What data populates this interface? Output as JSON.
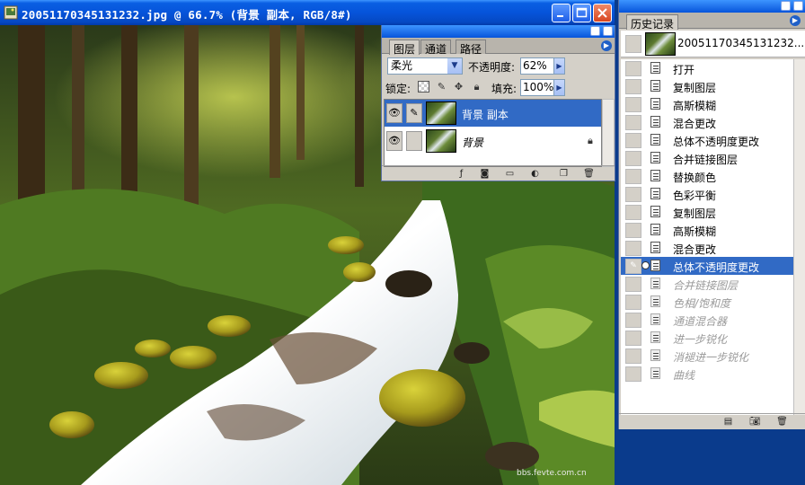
{
  "document": {
    "title": "20051170345131232.jpg @ 66.7% (背景 副本, RGB/8#)",
    "watermark": "bbs.fevte.com.cn"
  },
  "layers_panel": {
    "tabs": [
      "图层",
      "通道",
      "路径"
    ],
    "blend_mode": "柔光",
    "opacity_label": "不透明度:",
    "opacity_value": "62%",
    "lock_label": "锁定:",
    "fill_label": "填充:",
    "fill_value": "100%",
    "layers": [
      {
        "name": "背景 副本",
        "selected": true,
        "locked": false
      },
      {
        "name": "背景",
        "selected": false,
        "locked": true
      }
    ]
  },
  "history_panel": {
    "tab": "历史记录",
    "snapshot_name": "20051170345131232...",
    "items": [
      {
        "label": "打开",
        "state": "past"
      },
      {
        "label": "复制图层",
        "state": "past"
      },
      {
        "label": "高斯模糊",
        "state": "past"
      },
      {
        "label": "混合更改",
        "state": "past"
      },
      {
        "label": "总体不透明度更改",
        "state": "past"
      },
      {
        "label": "合并链接图层",
        "state": "past"
      },
      {
        "label": "替换颜色",
        "state": "past"
      },
      {
        "label": "色彩平衡",
        "state": "past"
      },
      {
        "label": "复制图层",
        "state": "past"
      },
      {
        "label": "高斯模糊",
        "state": "past"
      },
      {
        "label": "混合更改",
        "state": "past"
      },
      {
        "label": "总体不透明度更改",
        "state": "current"
      },
      {
        "label": "合并链接图层",
        "state": "future"
      },
      {
        "label": "色相/饱和度",
        "state": "future"
      },
      {
        "label": "通道混合器",
        "state": "future"
      },
      {
        "label": "进一步锐化",
        "state": "future"
      },
      {
        "label": "消褪进一步锐化",
        "state": "future"
      },
      {
        "label": "曲线",
        "state": "future"
      }
    ]
  },
  "icons": {
    "eye": "eye-icon",
    "brush": "brush-icon",
    "lock": "lock-icon",
    "history_brush": "history-brush-icon"
  }
}
